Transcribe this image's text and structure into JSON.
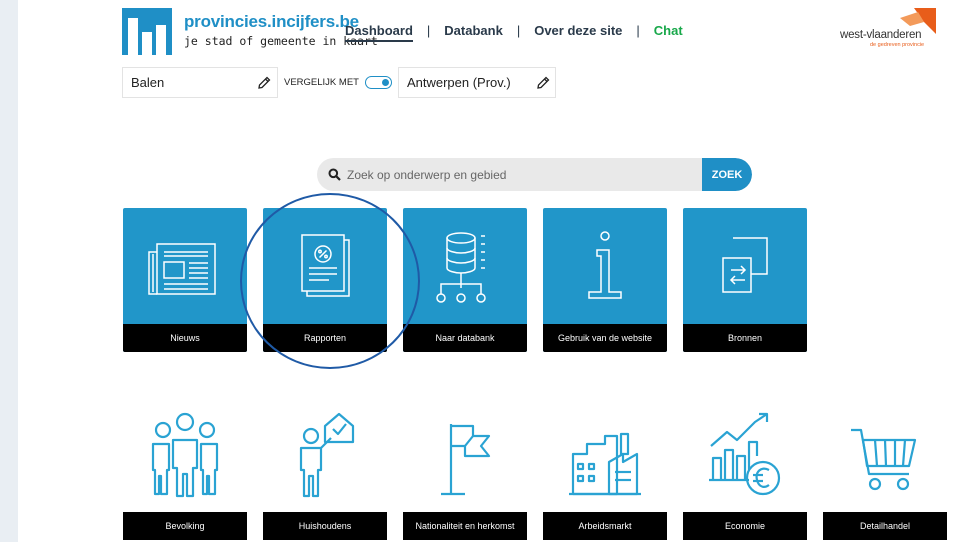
{
  "site": {
    "title": "provincies.incijfers.be",
    "subtitle": "je stad of gemeente in kaart",
    "partner_name": "west-vlaanderen",
    "partner_tagline": "de gedreven provincie",
    "brand_color": "#1f8fc6"
  },
  "nav": {
    "items": [
      "Dashboard",
      "Databank",
      "Over deze site",
      "Chat"
    ],
    "active": "Dashboard",
    "chat_color": "#18a84a"
  },
  "compare": {
    "place_value": "Balen",
    "compare_label": "VERGELIJK MET",
    "toggle_on": true,
    "compare_value": "Antwerpen (Prov.)"
  },
  "search": {
    "placeholder": "Zoek op onderwerp en gebied",
    "button_label": "ZOEK"
  },
  "tiles": [
    {
      "label": "Nieuws",
      "icon": "newspaper-icon"
    },
    {
      "label": "Rapporten",
      "icon": "report-icon"
    },
    {
      "label": "Naar databank",
      "icon": "database-icon"
    },
    {
      "label": "Gebruik van de website",
      "icon": "info-icon"
    },
    {
      "label": "Bronnen",
      "icon": "sources-icon"
    }
  ],
  "highlighted_tile": "Rapporten",
  "themes": [
    {
      "label": "Bevolking",
      "icon": "people-icon"
    },
    {
      "label": "Huishoudens",
      "icon": "household-icon"
    },
    {
      "label": "Nationaliteit en herkomst",
      "icon": "flag-icon"
    },
    {
      "label": "Arbeidsmarkt",
      "icon": "factory-icon"
    },
    {
      "label": "Economie",
      "icon": "economy-icon"
    },
    {
      "label": "Detailhandel",
      "icon": "shopping-cart-icon"
    }
  ],
  "colors": {
    "tile_blue": "#2196c9",
    "theme_blue": "#2aa3d3",
    "label_black": "#000000",
    "highlight_ring": "#1f5aa6"
  }
}
